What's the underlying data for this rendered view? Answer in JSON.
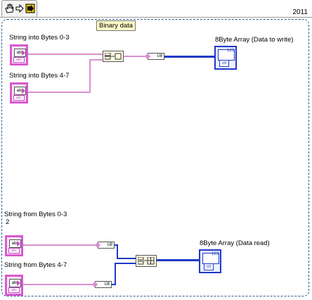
{
  "toolbar": {
    "icons": [
      "hand-icon",
      "arrow-icon",
      "run-icon"
    ]
  },
  "version": "2011",
  "note": "Binary data",
  "write_section": {
    "controls": [
      {
        "label": "String into Bytes 0-3",
        "type_glyph": "abc",
        "foot": "abc"
      },
      {
        "label": "String into Bytes 4-7",
        "type_glyph": "abc",
        "foot": "abc"
      }
    ],
    "cast_label": "U8",
    "indicator": {
      "label": "8Byte Array (Data to write)",
      "count": "123",
      "type": "U8"
    }
  },
  "read_section": {
    "controls": [
      {
        "label": "String from Bytes 0-3",
        "sublabel": "2",
        "type_glyph": "abc",
        "foot": "abc"
      },
      {
        "label": "String from Bytes 4-7",
        "type_glyph": "abc",
        "foot": "abc"
      }
    ],
    "cast_label": "U8",
    "indicator": {
      "label": "8Byte Array (Data read)",
      "count": "123",
      "type": "U8"
    }
  }
}
